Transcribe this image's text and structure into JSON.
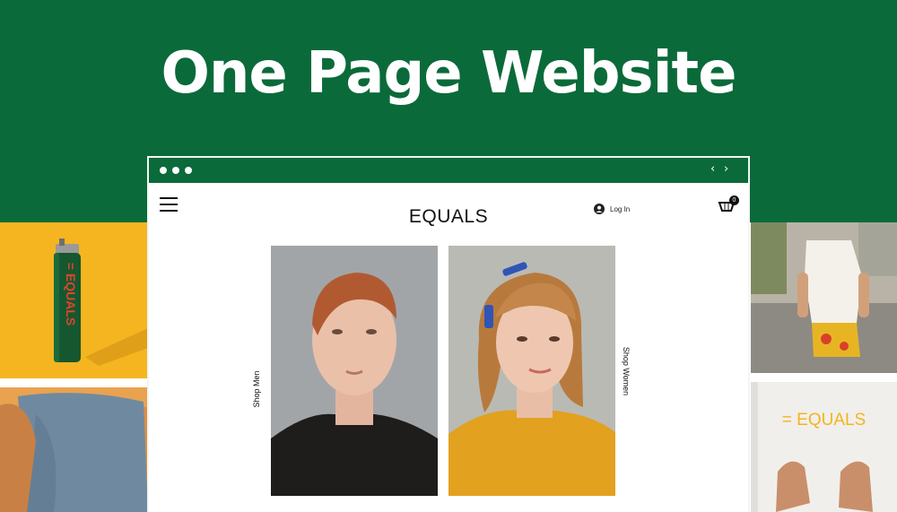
{
  "hero": {
    "title": "One Page Website"
  },
  "browser": {
    "nav_back": "‹",
    "nav_forward": "›",
    "brand": "EQUALS",
    "login_label": "Log In",
    "cart_count": "0",
    "shop_men": "Shop Men",
    "shop_women": "Shop Women"
  },
  "photos": {
    "lighter_text": "= EQUALS",
    "shirt_text": "= EQUALS"
  },
  "colors": {
    "brand_green": "#0b6a3a",
    "accent_yellow": "#f2b51a"
  }
}
